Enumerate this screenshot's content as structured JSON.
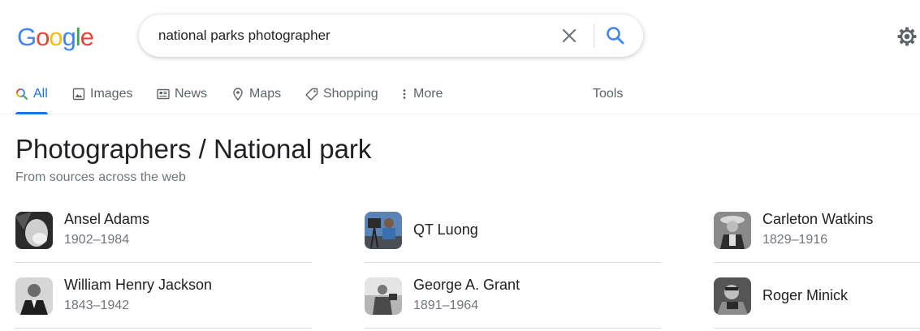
{
  "logo": {
    "letters": [
      "G",
      "o",
      "o",
      "g",
      "l",
      "e"
    ],
    "colors": [
      "#4285f4",
      "#ea4335",
      "#fbbc05",
      "#4285f4",
      "#34a853",
      "#ea4335"
    ]
  },
  "search": {
    "query": "national parks photographer",
    "placeholder": ""
  },
  "tabs": [
    {
      "label": "All",
      "icon": "search-icon",
      "active": true
    },
    {
      "label": "Images",
      "icon": "image-icon"
    },
    {
      "label": "News",
      "icon": "news-icon"
    },
    {
      "label": "Maps",
      "icon": "map-pin-icon"
    },
    {
      "label": "Shopping",
      "icon": "tag-icon"
    },
    {
      "label": "More",
      "icon": "more-vertical-icon"
    }
  ],
  "tools_label": "Tools",
  "panel": {
    "title": "Photographers / National park",
    "subtitle": "From sources across the web"
  },
  "people": [
    {
      "name": "Ansel Adams",
      "years": "1902–1984"
    },
    {
      "name": "QT Luong",
      "years": ""
    },
    {
      "name": "Carleton Watkins",
      "years": "1829–1916"
    },
    {
      "name": "William Henry Jackson",
      "years": "1843–1942"
    },
    {
      "name": "George A. Grant",
      "years": "1891–1964"
    },
    {
      "name": "Roger Minick",
      "years": ""
    }
  ],
  "colors": {
    "accent": "#1a73e8",
    "text_secondary": "#70757a"
  }
}
